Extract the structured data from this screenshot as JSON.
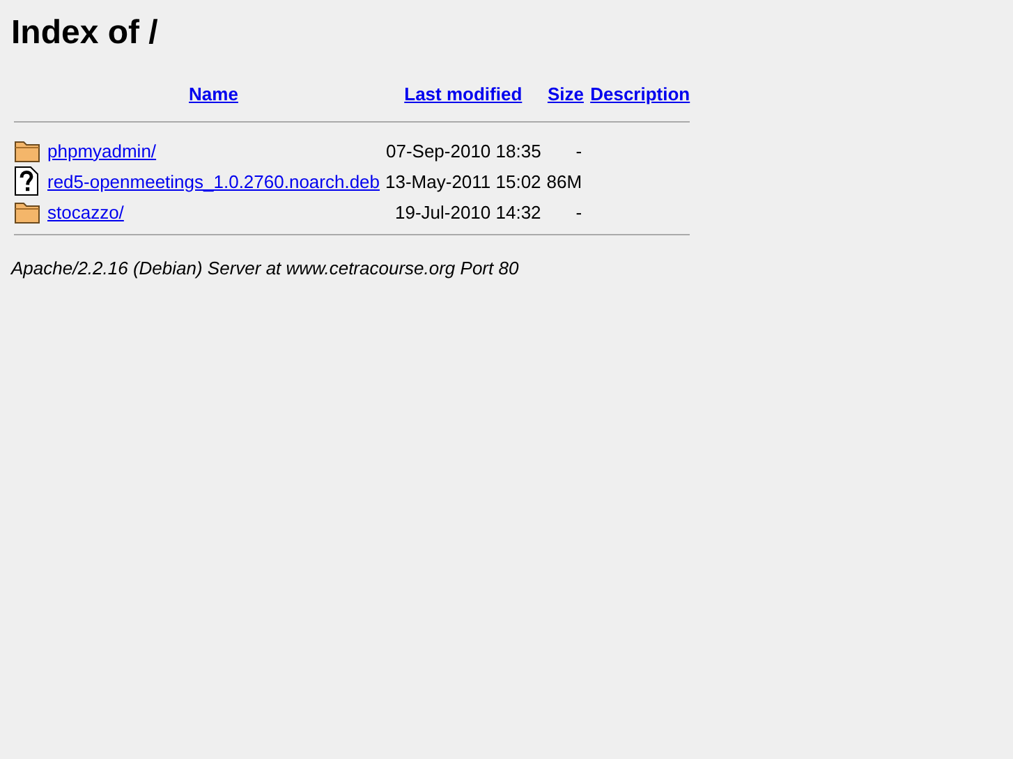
{
  "title": "Index of /",
  "columns": [
    {
      "label": "Name"
    },
    {
      "label": "Last modified"
    },
    {
      "label": "Size"
    },
    {
      "label": "Description"
    }
  ],
  "rows": [
    {
      "kind": "folder",
      "name": "phpmyadmin/",
      "modified": "07-Sep-2010 18:35",
      "size": "-"
    },
    {
      "kind": "unknown",
      "name": "red5-openmeetings_1.0.2760.noarch.deb",
      "modified": "13-May-2011 15:02",
      "size": "86M"
    },
    {
      "kind": "folder",
      "name": "stocazzo/",
      "modified": "19-Jul-2010 14:32",
      "size": "-"
    }
  ],
  "address": "Apache/2.2.16 (Debian) Server at www.cetracourse.org Port 80"
}
